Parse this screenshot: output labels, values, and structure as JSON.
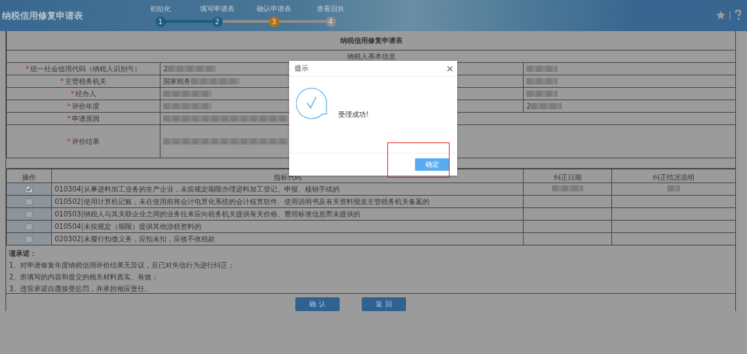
{
  "header": {
    "title": "纳税信用修复申请表",
    "steps": [
      {
        "number": "1",
        "label": "初始化",
        "done": true,
        "current": false
      },
      {
        "number": "2",
        "label": "填写申请表",
        "done": true,
        "current": false
      },
      {
        "number": "3",
        "label": "确认申请表",
        "done": false,
        "current": true
      },
      {
        "number": "4",
        "label": "查看回执",
        "done": false,
        "current": false
      }
    ]
  },
  "form": {
    "title": "纳税信用修复申请表",
    "section_title": "纳税人基本信息",
    "fields": [
      {
        "required_mark": "*",
        "label": "统一社会信用代码（纳税人识别号）",
        "value": "2",
        "redacted": true,
        "right_redacted": true
      },
      {
        "required_mark": "*",
        "label": "主管税务机关",
        "value": "国家税务",
        "redacted": true,
        "right_redacted": true
      },
      {
        "required_mark": "*",
        "label": "经办人",
        "redacted": true,
        "right_redacted": true
      },
      {
        "required_mark": "*",
        "label": "评价年度",
        "redacted": true,
        "right_value": "2",
        "right_redacted": true
      },
      {
        "required_mark": "*",
        "label": "申请原因",
        "redacted": true,
        "wide": true
      },
      {
        "required_mark": "*",
        "label": "评价结果",
        "redacted": true,
        "wide": true,
        "tall": true
      }
    ]
  },
  "indicators": {
    "columns": [
      "操作",
      "指标代码",
      "纠正日期",
      "纠正情况说明"
    ],
    "rows": [
      {
        "text": "010304|从事进料加工业务的生产企业，未按规定期限办理进料加工登记、申报、核销手续的",
        "checked": true,
        "redacted": true
      },
      {
        "text": "010502|使用计算机记账，未在使用前将会计电算化系统的会计核算软件、使用说明书及有关资料报送主管税务机关备案的",
        "checked": false,
        "redacted": false
      },
      {
        "text": "010503|纳税人与其关联企业之间的业务往来应向税务机关提供有关价格、费用标准信息而未提供的",
        "checked": false,
        "redacted": false
      },
      {
        "text": "010504|未按规定（期限）提供其他涉税资料的",
        "checked": false,
        "redacted": false
      },
      {
        "text": "020302|未履行扣缴义务，应扣未扣，应收不收税款",
        "checked": false,
        "redacted": false
      }
    ]
  },
  "promise": {
    "heading": "谨承诺：",
    "items": [
      "1、对申请修复年度纳税信用评价结果无异议，且已对失信行为进行纠正；",
      "2、所填写的内容和提交的相关材料真实、有效；",
      "3、违背承诺自愿接受惩罚，并承担相应责任。"
    ]
  },
  "buttons": [
    {
      "label": "确 认"
    },
    {
      "label": "返 回"
    }
  ],
  "dialog": {
    "title": "提示",
    "message": "受理成功!",
    "button": "确定",
    "highlighted": true
  }
}
